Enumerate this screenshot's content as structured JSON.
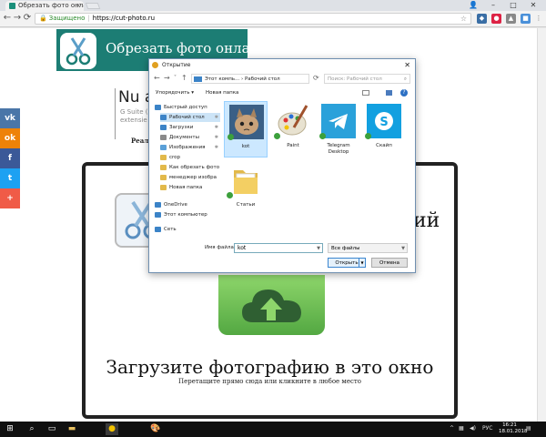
{
  "browser": {
    "tab_title": "Обрезать фото онлайн!",
    "secure_label": "Защищено",
    "url": "https://cut-photo.ru"
  },
  "page": {
    "logo_title": "Обрезать фото онлайн",
    "ad_title": "Nu a",
    "ad_line1": "G Suite (",
    "ad_line2": "extensie",
    "promo_text": "Реал",
    "heading_fragment": "ий",
    "upload_title": "Загрузите фотографию в это окно",
    "upload_subtitle": "Перетащите прямо сюда или кликните в любое место",
    "social": [
      {
        "label": "vk",
        "color": "#4a76a8"
      },
      {
        "label": "ok",
        "color": "#ee8208"
      },
      {
        "label": "f",
        "color": "#3b5998"
      },
      {
        "label": "t",
        "color": "#1da1f2"
      },
      {
        "label": "+",
        "color": "#f05b47"
      }
    ]
  },
  "dialog": {
    "title": "Открытие",
    "path": [
      "Этот компь...",
      "Рабочий стол"
    ],
    "search_placeholder": "Поиск: Рабочий стол",
    "organize": "Упорядочить ▾",
    "new_folder": "Новая папка",
    "nav_items": [
      {
        "label": "Быстрый доступ",
        "icon": "star-icon",
        "selected": false,
        "pinned": false
      },
      {
        "label": "Рабочий стол",
        "icon": "desktop-icon",
        "selected": true,
        "pinned": true
      },
      {
        "label": "Загрузки",
        "icon": "download-icon",
        "selected": false,
        "pinned": true
      },
      {
        "label": "Документы",
        "icon": "documents-icon",
        "selected": false,
        "pinned": true
      },
      {
        "label": "Изображения",
        "icon": "pictures-icon",
        "selected": false,
        "pinned": true
      },
      {
        "label": "crop",
        "icon": "folder-icon",
        "selected": false,
        "pinned": false
      },
      {
        "label": "Как обрезать фото",
        "icon": "folder-icon",
        "selected": false,
        "pinned": false
      },
      {
        "label": "менеджер изобра",
        "icon": "folder-icon",
        "selected": false,
        "pinned": false
      },
      {
        "label": "Новая папка",
        "icon": "folder-icon",
        "selected": false,
        "pinned": false
      },
      {
        "label": "OneDrive",
        "icon": "cloud-icon",
        "selected": false,
        "pinned": false
      },
      {
        "label": "Этот компьютер",
        "icon": "computer-icon",
        "selected": false,
        "pinned": false
      },
      {
        "label": "Сеть",
        "icon": "network-icon",
        "selected": false,
        "pinned": false
      }
    ],
    "files": [
      {
        "label": "kot",
        "kind": "image",
        "selected": true
      },
      {
        "label": "Paint",
        "kind": "app-paint",
        "selected": false
      },
      {
        "label": "Telegram Desktop",
        "kind": "app-telegram",
        "selected": false
      },
      {
        "label": "Скайп",
        "kind": "app-skype",
        "selected": false
      },
      {
        "label": "Статьи",
        "kind": "folder",
        "selected": false
      }
    ],
    "filename_label": "Имя файла:",
    "filename_value": "kot",
    "filetype": "Все файлы",
    "open_button": "Открыть",
    "cancel_button": "Отмена"
  },
  "taskbar": {
    "lang": "РУС",
    "time": "16:21",
    "date": "18.01.2018"
  }
}
